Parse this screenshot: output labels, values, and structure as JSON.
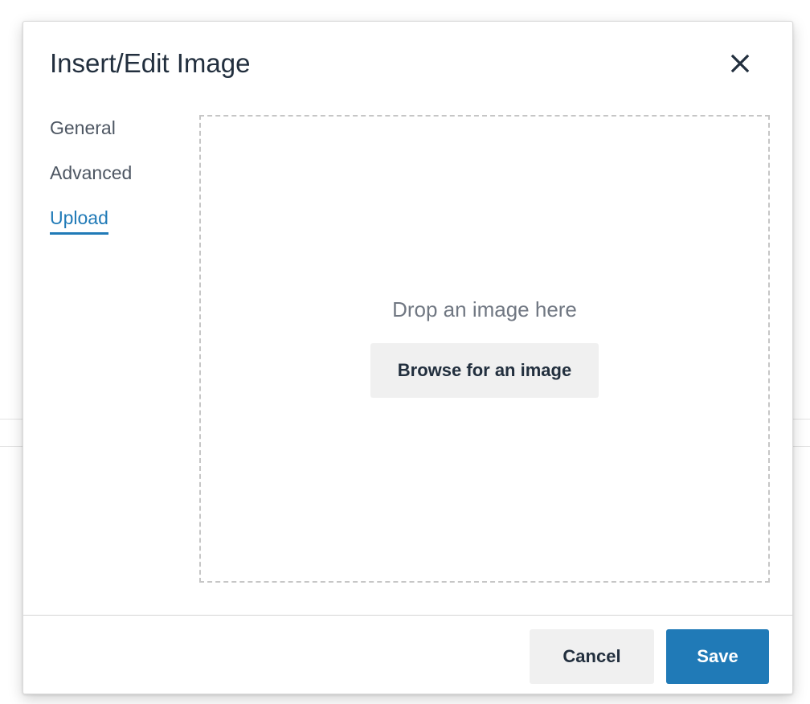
{
  "dialog": {
    "title": "Insert/Edit Image",
    "close_icon": "close-icon"
  },
  "tabs": [
    {
      "label": "General",
      "active": false
    },
    {
      "label": "Advanced",
      "active": false
    },
    {
      "label": "Upload",
      "active": true
    }
  ],
  "dropzone": {
    "message": "Drop an image here",
    "browse_label": "Browse for an image"
  },
  "footer": {
    "cancel_label": "Cancel",
    "save_label": "Save"
  },
  "colors": {
    "accent": "#207ab7",
    "title_text": "#222f3e",
    "tab_text": "#4d5662",
    "dropzone_border": "#c6c6c6",
    "secondary_button_bg": "#f0f0f0"
  }
}
